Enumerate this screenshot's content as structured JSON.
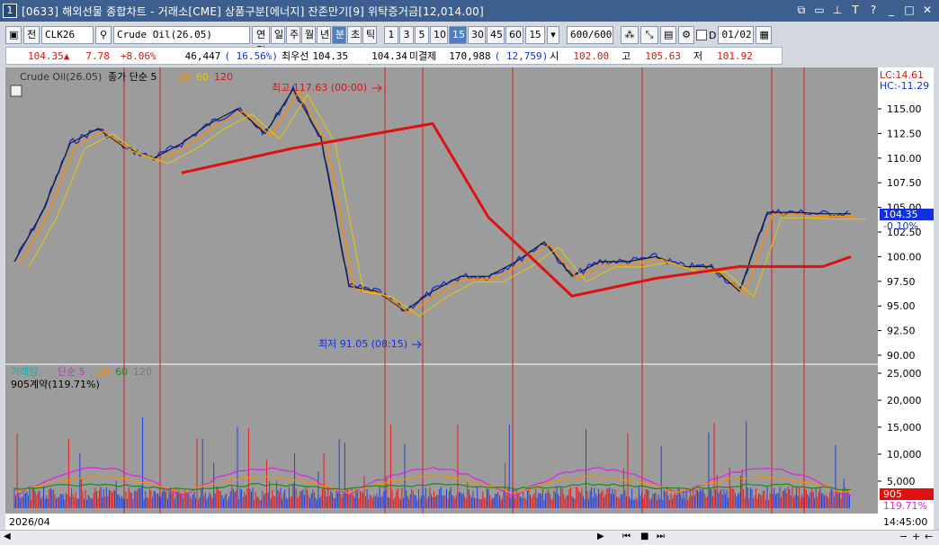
{
  "window": {
    "number": "1",
    "title": "[0633] 해외선물 종합차트 - 거래소[CME] 상품구분[에너지] 잔존만기[9] 위탁증거금[12,014.00]"
  },
  "toolbar": {
    "jeon": "전",
    "code": "CLK26",
    "name": "Crude Oil(26.05)",
    "periods": [
      "연결",
      "일",
      "주",
      "월",
      "년",
      "분",
      "초",
      "틱"
    ],
    "active_period": "분",
    "intervals": [
      "1",
      "3",
      "5",
      "10",
      "15",
      "30",
      "45",
      "60"
    ],
    "active_interval": "15",
    "interval_value": "15",
    "count": "600",
    "count_total": "/600",
    "checkbox_label": "D",
    "date": "01/02"
  },
  "info": {
    "price": "104.35",
    "change": "7.78",
    "change_pct": "+8.06%",
    "volume": "46,447",
    "vol_ratio": "( 16.56%)",
    "best_label": "최우선",
    "best_ask": "104.35",
    "best_bid": "104.34",
    "open_interest_label": "미결제",
    "open_interest": "170,988",
    "oi_change": "( 12,759)",
    "open_label": "시",
    "open": "102.00",
    "high_label": "고",
    "high": "105.63",
    "low_label": "저",
    "low": "101.92"
  },
  "price_panel": {
    "symbol_label": "Crude Oil(26.05)",
    "ma_label": "종가 단순 5",
    "ma_periods": [
      "20",
      "60",
      "120"
    ],
    "lc": "LC:14.61",
    "hc": "HC:-11.29",
    "high_annot": "최고 117.63 (00:00)",
    "low_annot": "최저 91.05 (08:15)",
    "last_price": "104.35",
    "last_change": "-0.10%",
    "y_ticks": [
      "115.00",
      "112.50",
      "110.00",
      "107.50",
      "105.00",
      "102.50",
      "100.00",
      "97.50",
      "95.00",
      "92.50",
      "90.00"
    ]
  },
  "volume_panel": {
    "label": "거래량",
    "ma_label": "단순 5",
    "ma_periods": [
      "20",
      "60",
      "120"
    ],
    "contracts": "905계약(119.71%)",
    "last_volume": "905",
    "last_ratio": "119.71%",
    "y_ticks": [
      "25,000",
      "20,000",
      "15,000",
      "10,000",
      "5,000"
    ]
  },
  "x_axis": {
    "start_label": "2026/04",
    "time": "14:45:00"
  },
  "colors": {
    "bg": "#9c9c9c",
    "ma5": "#1a1a1a",
    "ma20": "#ff8c00",
    "ma60": "#e8c800",
    "ma120": "#e01010",
    "vol_up": "#e02020",
    "vol_down": "#2040e0"
  },
  "chart_data": {
    "type": "line",
    "series": [
      {
        "name": "종가",
        "x": [
          0,
          20,
          40,
          60,
          80,
          100,
          120,
          140,
          160,
          180,
          200,
          220,
          240,
          260,
          280,
          300,
          320,
          340,
          360,
          380,
          400,
          420,
          440,
          460,
          480,
          500,
          520,
          540,
          560,
          580,
          600
        ],
        "values": [
          99.5,
          104.5,
          111.5,
          113.0,
          111.0,
          110.0,
          111.5,
          113.5,
          115.0,
          112.5,
          117.0,
          112.0,
          97.0,
          96.5,
          94.5,
          96.5,
          98.0,
          98.0,
          99.5,
          101.5,
          98.0,
          99.5,
          99.5,
          100.0,
          99.0,
          99.0,
          96.5,
          104.5,
          104.5,
          104.35,
          104.35
        ]
      },
      {
        "name": "120",
        "x": [
          120,
          200,
          260,
          300,
          340,
          400,
          460,
          520,
          580,
          600
        ],
        "values": [
          108.5,
          111.0,
          112.5,
          113.5,
          104.0,
          96.0,
          97.8,
          99.0,
          99.0,
          100.0
        ]
      }
    ],
    "ylim": [
      90,
      117.63
    ]
  }
}
